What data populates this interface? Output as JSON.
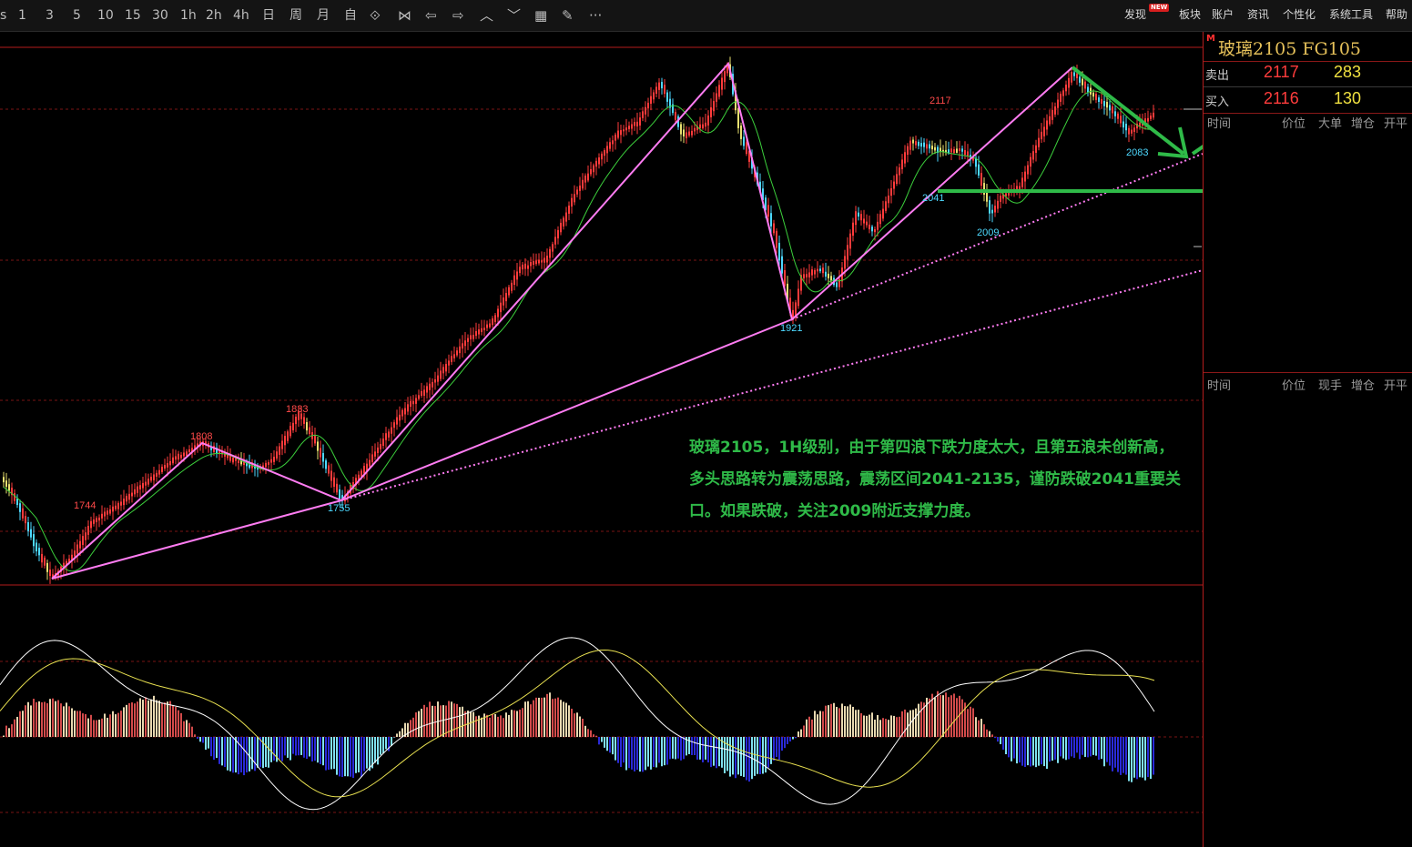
{
  "toolbar": {
    "periods": [
      "s",
      "1",
      "3",
      "5",
      "10",
      "15",
      "30",
      "1h",
      "2h",
      "4h",
      "日",
      "周",
      "月",
      "自"
    ],
    "tools": [
      "draw-arrows-icon",
      "bowtie-icon",
      "arrow-left-icon",
      "arrow-right-icon",
      "zoom-in-icon",
      "zoom-out-icon",
      "grid-icon",
      "pen-icon",
      "more-icon"
    ],
    "tool_glyphs": [
      "⟐",
      "⋈",
      "⇦",
      "⇨",
      "︿",
      "﹀",
      "▦",
      "✎",
      "···"
    ],
    "menu": [
      "发现",
      "板块",
      "账户",
      "资讯",
      "个性化",
      "系统工具",
      "帮助"
    ],
    "new_badge": "NEW"
  },
  "contract": {
    "marker": "M",
    "title": "玻璃2105  FG105",
    "sell_label": "卖出",
    "sell_price": "2117",
    "sell_volume": "283",
    "buy_label": "买入",
    "buy_price": "2116",
    "buy_volume": "130"
  },
  "tick_table_1": {
    "headers": [
      "时间",
      "价位",
      "大单",
      "增仓",
      "开平"
    ]
  },
  "tick_table_2": {
    "headers": [
      "时间",
      "价位",
      "现手",
      "增仓",
      "开平"
    ]
  },
  "price_labels": {
    "p1744": "1744",
    "p1808": "1808",
    "p1833": "1833",
    "p1755": "1755",
    "p1921": "1921",
    "p2117": "2117",
    "p2041": "2041",
    "p2009": "2009",
    "p2083": "2083"
  },
  "annotation": "玻璃2105，1H级别，由于第四浪下跌力度太大，且第五浪未创新高，多头思路转为震荡思路，震荡区间2041-2135，谨防跌破2041重要关口。如果跌破，关注2009附近支撑力度。",
  "colors": {
    "up": "#ff3b3b",
    "down": "#4dd9ff",
    "wave_line": "#ff7cf2",
    "ma_line": "#3ccf3c",
    "forecast": "#2fba48",
    "grid": "#7a1515"
  }
}
